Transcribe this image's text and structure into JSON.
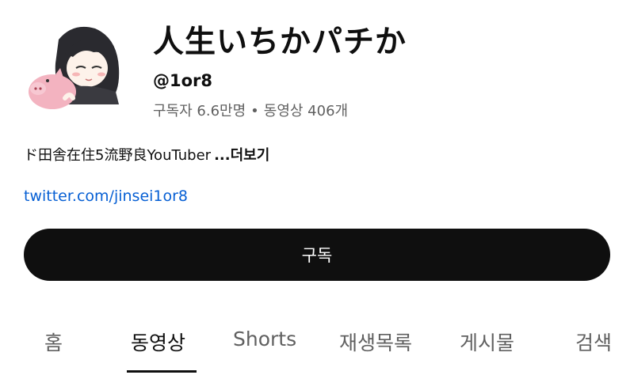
{
  "channel": {
    "name": "人生いちかパチか",
    "handle": "@1or8",
    "subscribers": "구독자 6.6만명",
    "separator": "•",
    "videos": "동영상 406개",
    "description": "ド田舎在住5流野良YouTuber",
    "more_label": "...더보기",
    "link": "twitter.com/jinsei1or8"
  },
  "actions": {
    "subscribe_label": "구독"
  },
  "tabs": [
    {
      "label": "홈",
      "active": false
    },
    {
      "label": "동영상",
      "active": true
    },
    {
      "label": "Shorts",
      "active": false
    },
    {
      "label": "재생목록",
      "active": false
    },
    {
      "label": "게시물",
      "active": false
    },
    {
      "label": "검색",
      "active": false
    }
  ],
  "colors": {
    "primary_text": "#0f0f0f",
    "secondary_text": "#606060",
    "link": "#065fd4",
    "subscribe_bg": "#0f0f0f"
  }
}
